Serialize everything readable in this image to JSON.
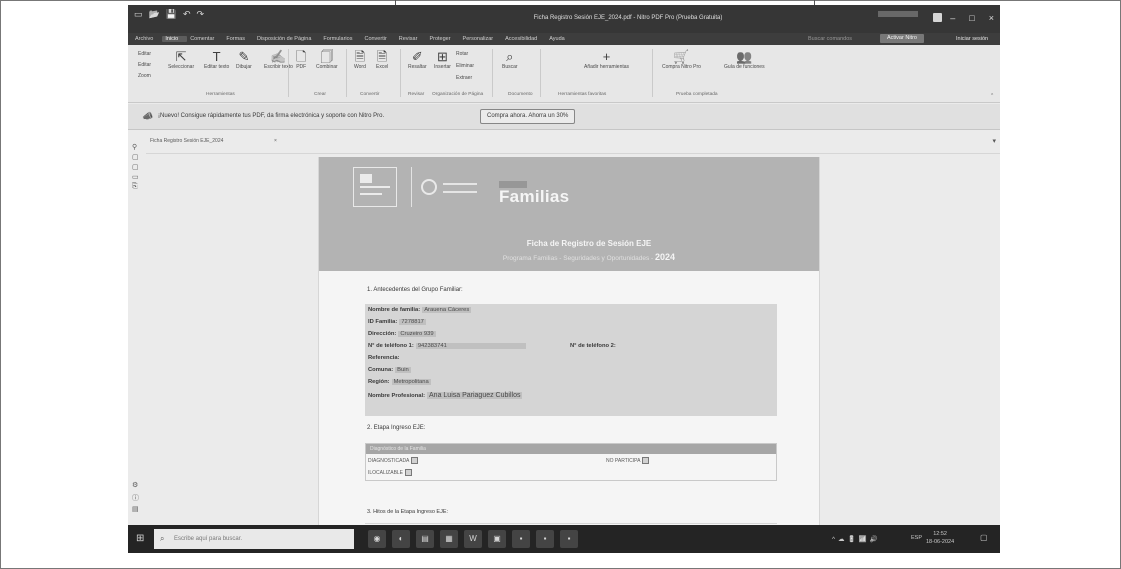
{
  "window": {
    "title": "Ficha Registro Sesión EJE_2024.pdf - Nitro PDF Pro (Prueba Gratuita)",
    "controls": {
      "minimize": "–",
      "maximize": "□",
      "close": "×"
    }
  },
  "menu": {
    "tabs": [
      "Archivo",
      "Inicio",
      "Comentar",
      "Formas",
      "Disposición de Página",
      "Formularios",
      "Convertir",
      "Revisar",
      "Proteger",
      "Personalizar",
      "Accesibilidad",
      "Ayuda"
    ],
    "active_tab": "Inicio",
    "search_placeholder": "Buscar comandos",
    "trial_button": "Activar Nitro",
    "login": "Iniciar sesión"
  },
  "ribbon": {
    "side_items": [
      "Editar",
      "Editar",
      "Zoom"
    ],
    "buttons": [
      {
        "icon": "⇱",
        "label": "Seleccionar"
      },
      {
        "icon": "T",
        "label": "Editar texto"
      },
      {
        "icon": "✎",
        "label": "Dibujar"
      },
      {
        "icon": "✍",
        "label": "Escribir texto"
      },
      {
        "icon": "🗋",
        "label": "PDF"
      },
      {
        "icon": "🗍",
        "label": "Combinar"
      },
      {
        "icon": "🗎",
        "label": "Word"
      },
      {
        "icon": "🗎",
        "label": "Excel"
      },
      {
        "icon": "✐",
        "label": "Resaltar"
      },
      {
        "icon": "⊞",
        "label": "Insertar"
      },
      {
        "icon": "⌕",
        "label": "Buscar"
      },
      {
        "icon": "+",
        "label": "Añadir herramientas"
      },
      {
        "icon": "🛒",
        "label": "Compra Nitro Pro"
      },
      {
        "icon": "👥",
        "label": "Guía de funciones"
      }
    ],
    "stack_items": [
      "Rotar",
      "Eliminar",
      "Extraer"
    ],
    "groups": [
      "Herramientas",
      "Crear",
      "Convertir",
      "Revisar",
      "Organización de Página",
      "Documento",
      "Herramientas favoritas",
      "Prueba completada"
    ]
  },
  "promo": {
    "text": "¡Nuevo! Consigue rápidamente tus PDF, da firma electrónica y soporte con Nitro Pro.",
    "button": "Compra ahora. Ahorra un 30%"
  },
  "doc_tab": {
    "label": "Ficha Registro Sesión EJE_2024",
    "close": "×"
  },
  "document": {
    "banner": {
      "program_brand": "Familias",
      "form_title": "Ficha de Registro de Sesión EJE",
      "form_subtitle": "Programa Familias - Seguridades y Oportunidades -",
      "year": "2024"
    },
    "section1_title": "1. Antecedentes del Grupo Familiar:",
    "fields": [
      {
        "label": "Nombre de familia:",
        "value": "Arauena Cáceres"
      },
      {
        "label": "ID Familia:",
        "value": "7278817"
      },
      {
        "label": "Dirección:",
        "value": "Cruzeiro 939"
      },
      {
        "label": "N° de teléfono 1:",
        "value": "942383741"
      },
      {
        "label": "N° de teléfono 2:",
        "value": ""
      },
      {
        "label": "Referencia:",
        "value": ""
      },
      {
        "label": "Comuna:",
        "value": "Buin"
      },
      {
        "label": "Región:",
        "value": "Metropolitana"
      },
      {
        "label": "Nombre Profesional:",
        "value": "Ana Luisa Pariaguez Cubillos"
      }
    ],
    "section2_title": "2. Etapa Ingreso EJE:",
    "stage_header": "Diagnóstico de la Familia",
    "stage_options": [
      "DIAGNOSTICADA",
      "NO PARTICIPA",
      "ILOCALIZABLE"
    ],
    "section3_title": "3. Hitos de la Etapa Ingreso EJE:"
  },
  "taskbar": {
    "search_placeholder": "Escribe aquí para buscar.",
    "language": "ESP",
    "time": "12:52",
    "date": "18-06-2024"
  }
}
